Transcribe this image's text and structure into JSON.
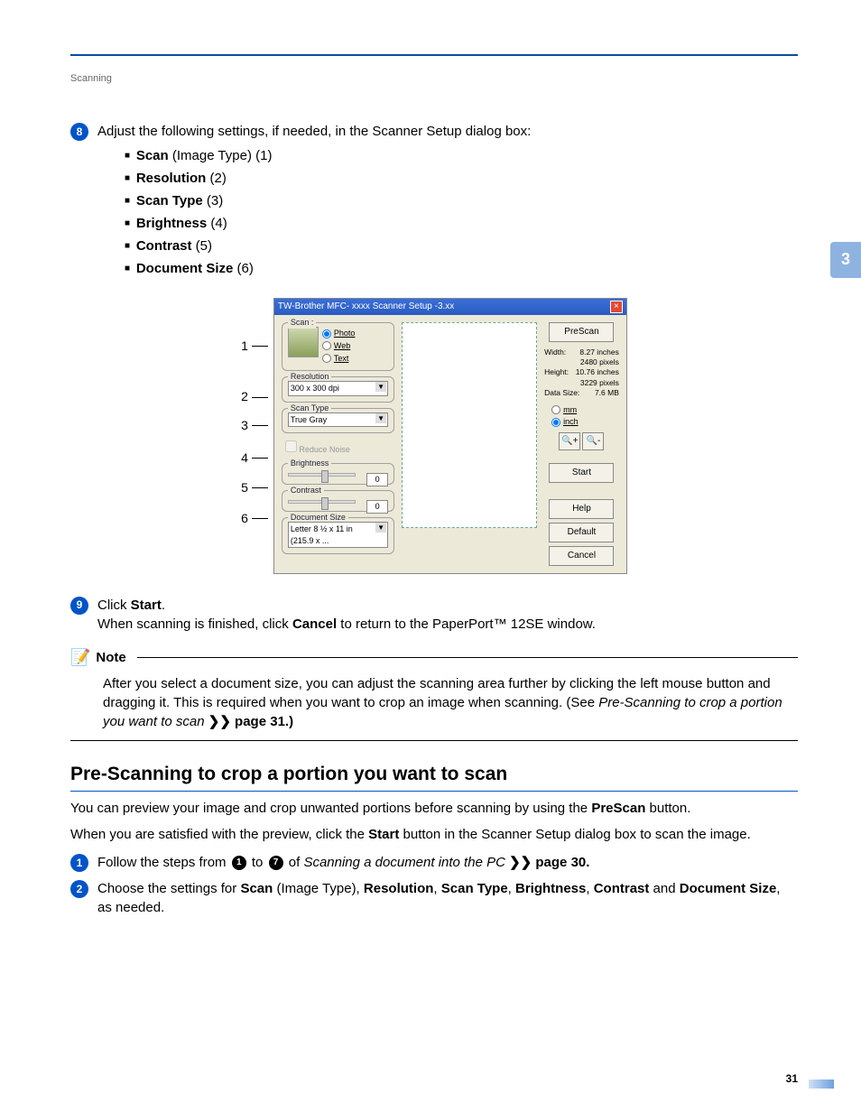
{
  "header": {
    "section": "Scanning",
    "chapter": "3"
  },
  "step8": {
    "num": "8",
    "intro": "Adjust the following settings, if needed, in the Scanner Setup dialog box:",
    "items": [
      {
        "bold": "Scan",
        "rest": " (Image Type) (1)"
      },
      {
        "bold": "Resolution",
        "rest": " (2)"
      },
      {
        "bold": "Scan Type",
        "rest": " (3)"
      },
      {
        "bold": "Brightness",
        "rest": " (4)"
      },
      {
        "bold": "Contrast",
        "rest": " (5)"
      },
      {
        "bold": "Document Size",
        "rest": " (6)"
      }
    ]
  },
  "callouts": [
    "1",
    "2",
    "3",
    "4",
    "5",
    "6"
  ],
  "dialog": {
    "title": "TW-Brother MFC- xxxx Scanner Setup -3.xx",
    "scan_group": "Scan :",
    "photo": "Photo",
    "web": "Web",
    "text": "Text",
    "resolution_label": "Resolution",
    "resolution_value": "300 x 300 dpi",
    "scan_type_label": "Scan Type",
    "scan_type_value": "True Gray",
    "reduce_noise": "Reduce Noise",
    "brightness_label": "Brightness",
    "brightness_value": "0",
    "contrast_label": "Contrast",
    "contrast_value": "0",
    "doc_size_label": "Document Size",
    "doc_size_value": "Letter 8 ½ x 11 in (215.9 x ...",
    "prescan_btn": "PreScan",
    "width_label": "Width:",
    "width_value": "8.27 inches",
    "width_px": "2480 pixels",
    "height_label": "Height:",
    "height_value": "10.76 inches",
    "height_px": "3229 pixels",
    "datasize_label": "Data Size:",
    "datasize_value": "7.6 MB",
    "unit_mm": "mm",
    "unit_inch": "inch",
    "start_btn": "Start",
    "help_btn": "Help",
    "default_btn": "Default",
    "cancel_btn": "Cancel"
  },
  "step9": {
    "num": "9",
    "line1_pre": "Click ",
    "line1_bold": "Start",
    "line1_post": ".",
    "line2_pre": "When scanning is finished, click ",
    "line2_bold": "Cancel",
    "line2_post": " to return to the PaperPort™ 12SE window."
  },
  "note": {
    "label": "Note",
    "p1": "After you select a document size, you can adjust the scanning area further by clicking the left mouse button and dragging it. This is required when you want to crop an image when scanning. (See ",
    "ital": "Pre-Scanning to crop a portion you want to scan",
    "p2": " ❯❯ page 31.)"
  },
  "subheading": "Pre-Scanning to crop a portion you want to scan",
  "para1_pre": "You can preview your image and crop unwanted portions before scanning by using the ",
  "para1_bold": "PreScan",
  "para1_post": " button.",
  "para2_pre": "When you are satisfied with the preview, click the ",
  "para2_bold": "Start",
  "para2_post": " button in the Scanner Setup dialog box to scan the image.",
  "stepA": {
    "num": "1",
    "pre": "Follow the steps from ",
    "c1": "1",
    "mid": " to ",
    "c2": "7",
    "post_pre": " of ",
    "ital": "Scanning a document into the PC",
    "post": " ❯❯ page 30."
  },
  "stepB": {
    "num": "2",
    "pre": "Choose the settings for ",
    "b1": "Scan",
    "t1": " (Image Type), ",
    "b2": "Resolution",
    "t2": ", ",
    "b3": "Scan Type",
    "t3": ", ",
    "b4": "Brightness",
    "t4": ", ",
    "b5": "Contrast",
    "t5": " and ",
    "b6": "Document Size",
    "t6": ", as needed."
  },
  "page_number": "31"
}
